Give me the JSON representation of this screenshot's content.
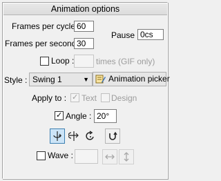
{
  "panel": {
    "title": "Animation options"
  },
  "frames_per_cycle": {
    "label": "Frames per cycle :",
    "value": "60"
  },
  "frames_per_second": {
    "label": "Frames per second :",
    "value": "30"
  },
  "pause": {
    "label": "Pause :",
    "value": "0cs"
  },
  "loop": {
    "label": "Loop :",
    "checked": false,
    "value": "",
    "suffix": "times (GIF only)"
  },
  "style": {
    "label": "Style :",
    "selected": "Swing 1"
  },
  "animation_picker": {
    "label": "Animation picker"
  },
  "apply_to": {
    "label": "Apply to :",
    "text_label": "Text",
    "text_checked": true,
    "design_label": "Design",
    "design_checked": false
  },
  "angle": {
    "label": "Angle :",
    "checked": true,
    "value": "20°"
  },
  "motion_buttons": {
    "icons": [
      "rotate-swing-icon",
      "flip-horizontal-icon",
      "rotate-clockwise-icon",
      "u-turn-icon"
    ],
    "active": "rotate-swing-icon"
  },
  "wave": {
    "label": "Wave :",
    "checked": false,
    "value": ""
  },
  "wave_buttons": [
    "horizontal-arrows-icon",
    "vertical-arrows-icon"
  ]
}
